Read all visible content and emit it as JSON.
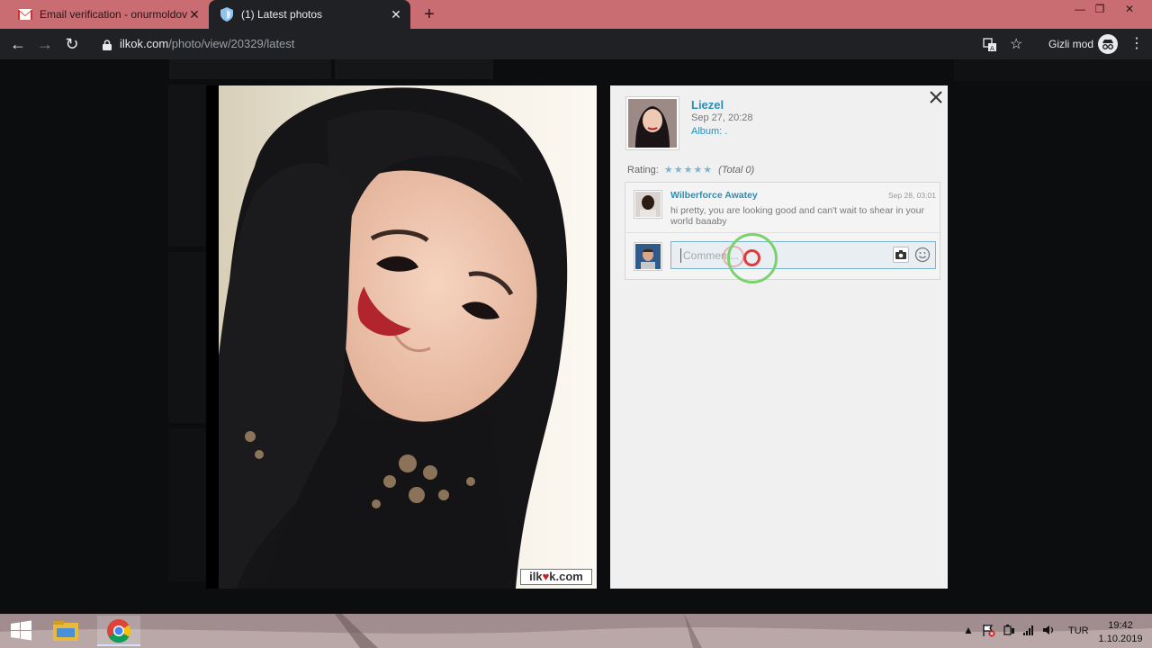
{
  "browser": {
    "tabs": [
      {
        "title": "Email verification - onurmoldova",
        "active": false,
        "icon": "gmail-icon"
      },
      {
        "title": "(1) Latest photos",
        "active": true,
        "icon": "ilkok-icon"
      }
    ],
    "url_host": "ilkok.com",
    "url_path": "/photo/view/20329/latest",
    "incognito_label": "Gizli mod"
  },
  "photo": {
    "watermark_left": "ilk",
    "watermark_heart": "♥",
    "watermark_right": "k.com"
  },
  "panel": {
    "owner": {
      "name": "Liezel",
      "date": "Sep 27, 20:28",
      "album": "Album: ."
    },
    "rating": {
      "label": "Rating:",
      "stars": "★★★★★",
      "total": "(Total 0)"
    },
    "comments": [
      {
        "author": "Wilberforce Awatey",
        "date": "Sep 28, 03:01",
        "text": "hi pretty, you are looking good and can't wait to shear in your world baaaby"
      }
    ],
    "comment_input": {
      "placeholder": "Comment..."
    }
  },
  "taskbar": {
    "language": "TUR",
    "time": "19:42",
    "date": "1.10.2019"
  },
  "colors": {
    "tab_bar": "#c96d72",
    "toolbar": "#202124",
    "link_blue": "#2a8fb5",
    "cursor_ring": "#79d36c",
    "cursor_dot": "#e23a3a"
  }
}
